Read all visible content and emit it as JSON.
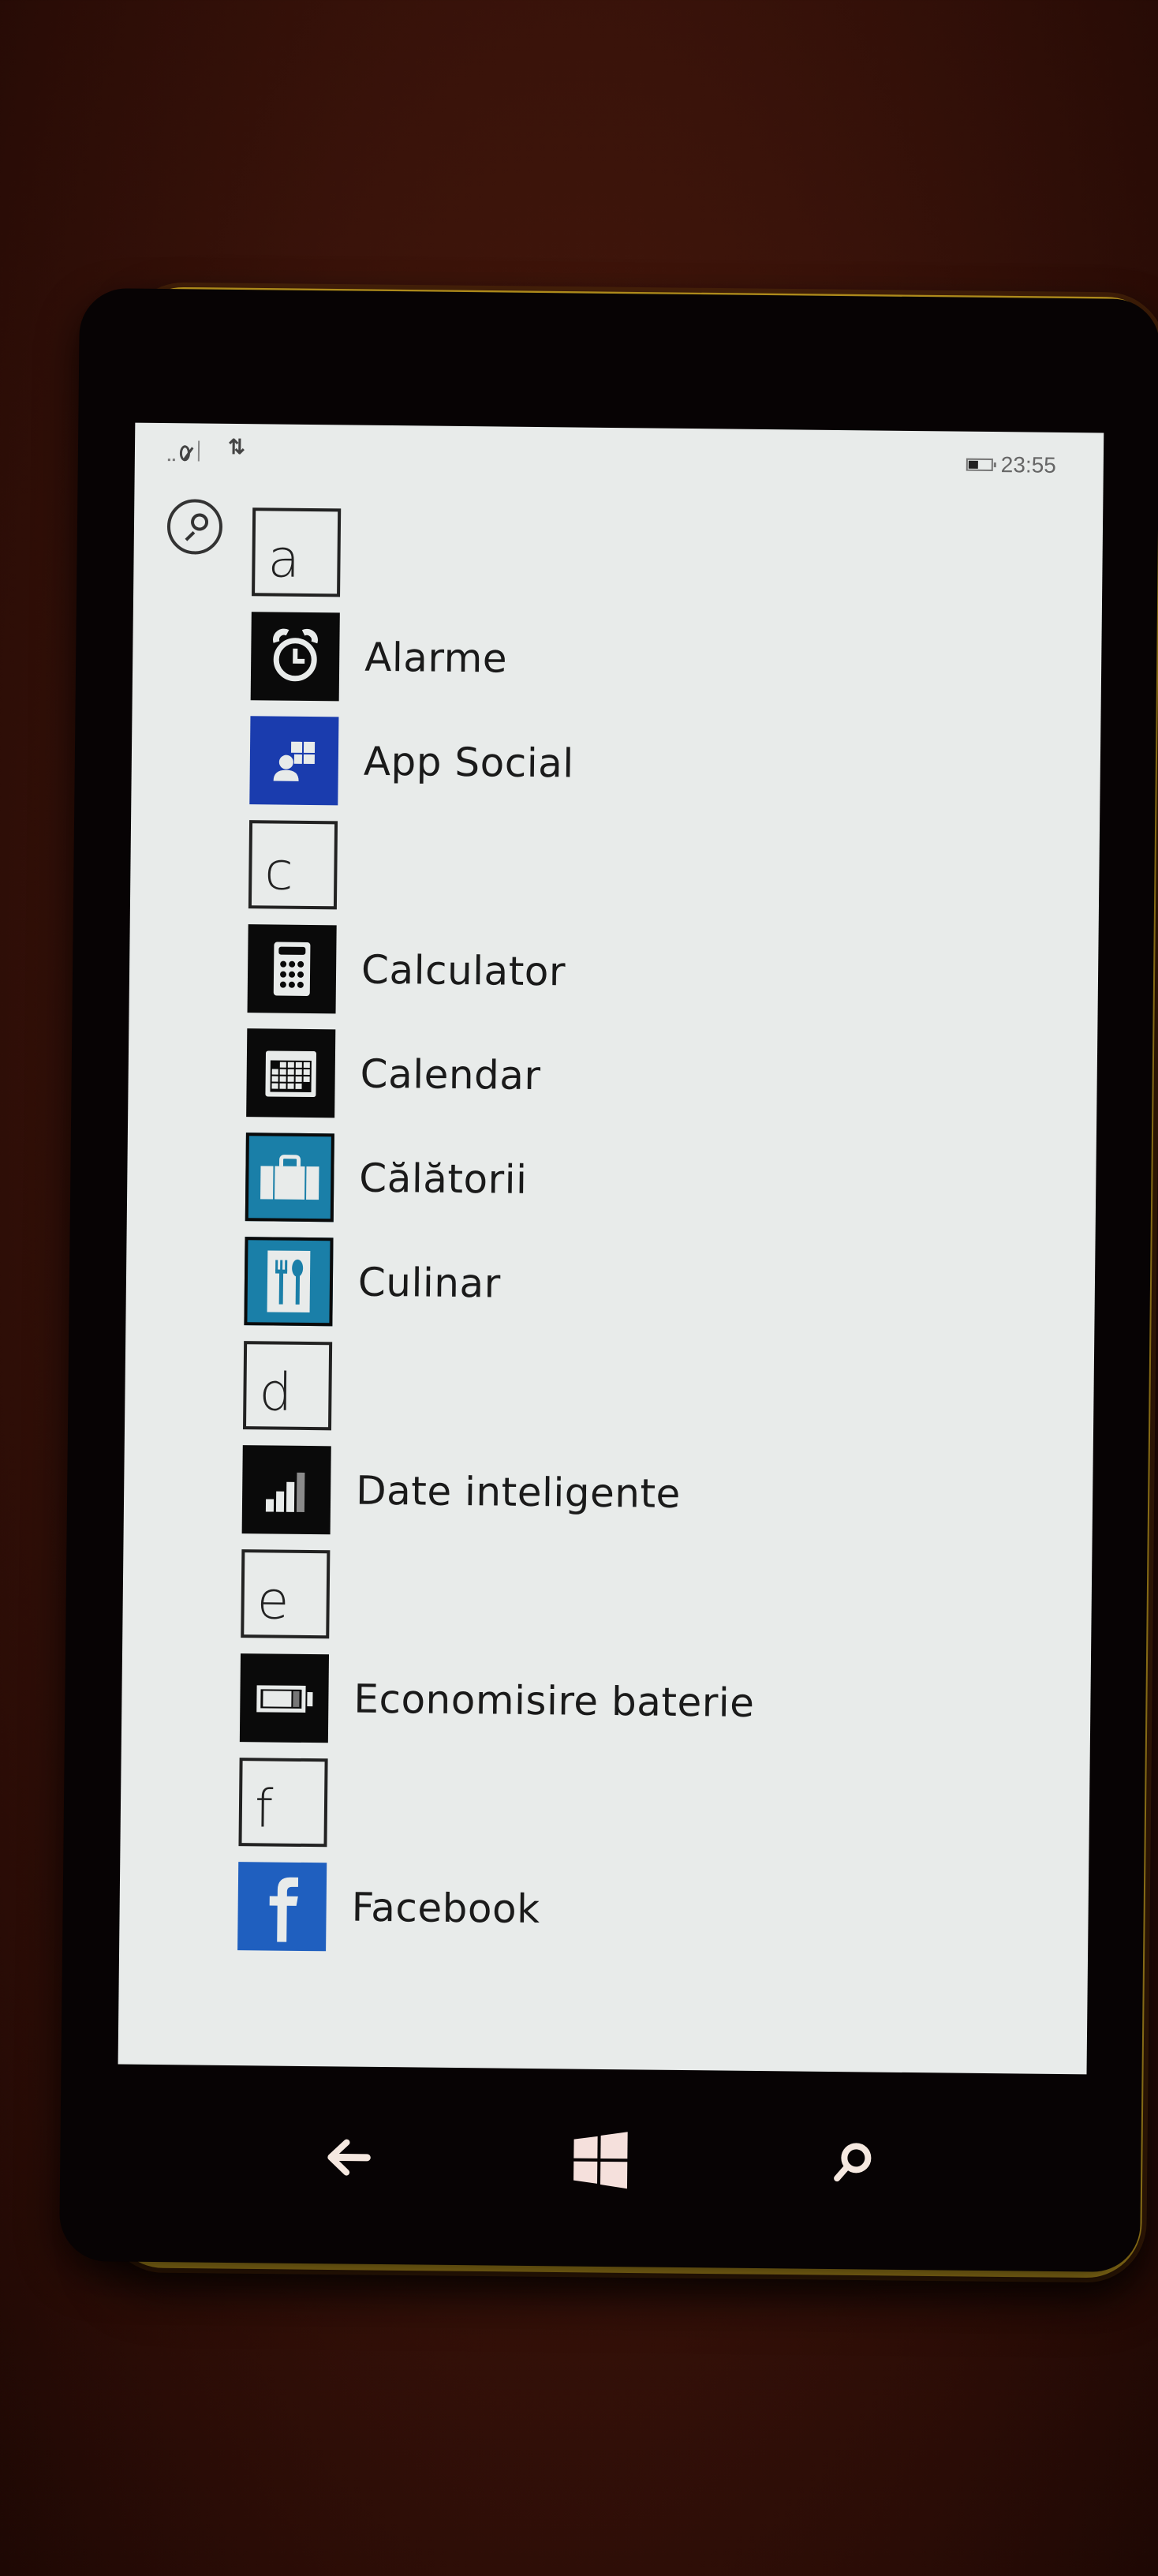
{
  "status_bar": {
    "time": "23:55",
    "battery_level": "low",
    "left_icons": [
      "signal-icon",
      "no-sim-icon",
      "data-transfer-icon"
    ]
  },
  "app_list": {
    "search_button": "search-icon",
    "groups": [
      {
        "letter": "a",
        "apps": [
          {
            "name": "Alarme",
            "icon": "alarm-clock-icon",
            "tile_color": "#0a0a0a"
          },
          {
            "name": "App Social",
            "icon": "app-social-icon",
            "tile_color": "#1a3cae"
          }
        ]
      },
      {
        "letter": "c",
        "apps": [
          {
            "name": "Calculator",
            "icon": "calculator-icon",
            "tile_color": "#0a0a0a"
          },
          {
            "name": "Calendar",
            "icon": "calendar-icon",
            "tile_color": "#0a0a0a"
          },
          {
            "name": "Călătorii",
            "icon": "suitcase-icon",
            "tile_color": "#1a7fa8"
          },
          {
            "name": "Culinar",
            "icon": "fork-spoon-icon",
            "tile_color": "#1a7fa8"
          }
        ]
      },
      {
        "letter": "d",
        "apps": [
          {
            "name": "Date inteligente",
            "icon": "data-sense-icon",
            "tile_color": "#0a0a0a"
          }
        ]
      },
      {
        "letter": "e",
        "apps": [
          {
            "name": "Economisire baterie",
            "icon": "battery-saver-icon",
            "tile_color": "#0a0a0a"
          }
        ]
      },
      {
        "letter": "f",
        "apps": [
          {
            "name": "Facebook",
            "icon": "facebook-icon",
            "tile_color": "#1f5fbf"
          }
        ]
      }
    ]
  },
  "nav_bar": {
    "back": "back-arrow-icon",
    "start": "windows-logo-icon",
    "search": "search-icon"
  }
}
